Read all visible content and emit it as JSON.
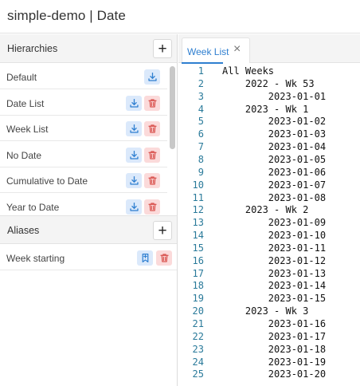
{
  "app": {
    "title": "simple-demo | Date"
  },
  "hierarchies": {
    "header": "Hierarchies",
    "add_symbol": "+",
    "items": [
      {
        "label": "Default",
        "deletable": false
      },
      {
        "label": "Date List",
        "deletable": true
      },
      {
        "label": "Week List",
        "deletable": true
      },
      {
        "label": "No Date",
        "deletable": true
      },
      {
        "label": "Cumulative to Date",
        "deletable": true
      },
      {
        "label": "Year to Date",
        "deletable": true
      }
    ]
  },
  "aliases": {
    "header": "Aliases",
    "add_symbol": "+",
    "items": [
      {
        "label": "Week starting"
      }
    ]
  },
  "editor": {
    "tab_label": "Week List",
    "close_symbol": "×",
    "lines": [
      "All Weeks",
      "    2022 - Wk 53",
      "        2023-01-01",
      "    2023 - Wk 1",
      "        2023-01-02",
      "        2023-01-03",
      "        2023-01-04",
      "        2023-01-05",
      "        2023-01-06",
      "        2023-01-07",
      "        2023-01-08",
      "    2023 - Wk 2",
      "        2023-01-09",
      "        2023-01-10",
      "        2023-01-11",
      "        2023-01-12",
      "        2023-01-13",
      "        2023-01-14",
      "        2023-01-15",
      "    2023 - Wk 3",
      "        2023-01-16",
      "        2023-01-17",
      "        2023-01-18",
      "        2023-01-19",
      "        2023-01-20"
    ]
  },
  "colors": {
    "accent": "#2f7fd0",
    "download_bg": "#dbe9fb",
    "delete_bg": "#fbdada",
    "delete_icon": "#d9534f",
    "line_number": "#2a7a9a"
  },
  "icons": {
    "download": "download-icon",
    "delete": "trash-icon",
    "alias_edit": "bookmark-icon",
    "add": "plus-icon",
    "close": "close-icon"
  }
}
